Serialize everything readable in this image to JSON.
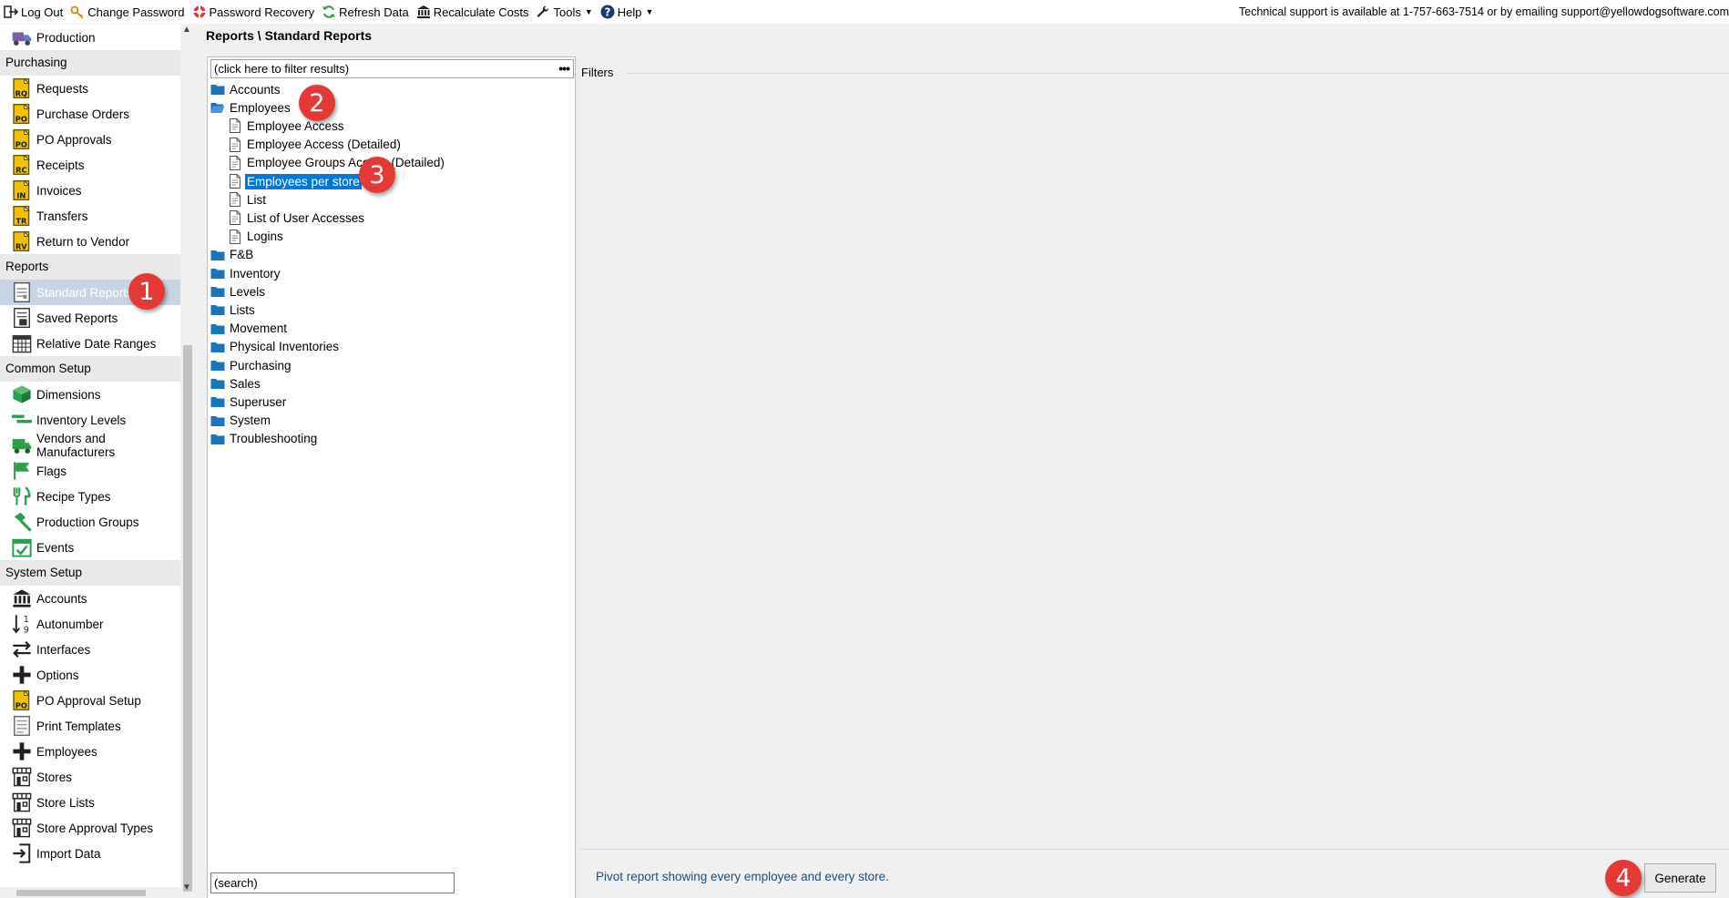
{
  "toolbar": {
    "items": [
      {
        "label": "Log Out",
        "icon": "logout-icon"
      },
      {
        "label": "Change Password",
        "icon": "key-icon"
      },
      {
        "label": "Password Recovery",
        "icon": "lifebuoy-icon"
      },
      {
        "label": "Refresh Data",
        "icon": "refresh-icon"
      },
      {
        "label": "Recalculate Costs",
        "icon": "bank-icon"
      },
      {
        "label": "Tools",
        "icon": "wrench-icon"
      },
      {
        "label": "Help",
        "icon": "help-icon"
      }
    ],
    "support_text": "Technical support is available at 1-757-663-7514 or by emailing support@yellowdogsoftware.com"
  },
  "nav": {
    "items": [
      {
        "type": "item",
        "label": "Production",
        "icon": "truck-icon"
      },
      {
        "type": "section",
        "label": "Purchasing"
      },
      {
        "type": "item",
        "label": "Requests",
        "icon": "doc-rq-icon",
        "code": "RQ"
      },
      {
        "type": "item",
        "label": "Purchase Orders",
        "icon": "doc-po-icon",
        "code": "PO"
      },
      {
        "type": "item",
        "label": "PO Approvals",
        "icon": "doc-po-approval-icon",
        "code": "PO"
      },
      {
        "type": "item",
        "label": "Receipts",
        "icon": "doc-rc-icon",
        "code": "RC"
      },
      {
        "type": "item",
        "label": "Invoices",
        "icon": "doc-in-icon",
        "code": "IN"
      },
      {
        "type": "item",
        "label": "Transfers",
        "icon": "doc-tr-icon",
        "code": "TR"
      },
      {
        "type": "item",
        "label": "Return to Vendor",
        "icon": "doc-rv-icon",
        "code": "RV"
      },
      {
        "type": "section",
        "label": "Reports"
      },
      {
        "type": "item",
        "label": "Standard Reports",
        "icon": "report-icon",
        "selected": true
      },
      {
        "type": "item",
        "label": "Saved Reports",
        "icon": "saved-report-icon"
      },
      {
        "type": "item",
        "label": "Relative Date Ranges",
        "icon": "calendar-icon"
      },
      {
        "type": "section",
        "label": "Common Setup"
      },
      {
        "type": "item",
        "label": "Dimensions",
        "icon": "cube-icon"
      },
      {
        "type": "item",
        "label": "Inventory Levels",
        "icon": "levels-icon"
      },
      {
        "type": "item",
        "label": "Vendors and Manufacturers",
        "icon": "delivery-truck-icon"
      },
      {
        "type": "item",
        "label": "Flags",
        "icon": "flag-icon"
      },
      {
        "type": "item",
        "label": "Recipe Types",
        "icon": "utensils-icon"
      },
      {
        "type": "item",
        "label": "Production Groups",
        "icon": "hammer-icon"
      },
      {
        "type": "item",
        "label": "Events",
        "icon": "calendar-check-icon"
      },
      {
        "type": "section",
        "label": "System Setup"
      },
      {
        "type": "item",
        "label": "Accounts",
        "icon": "bank-icon"
      },
      {
        "type": "item",
        "label": "Autonumber",
        "icon": "sort-numeric-icon"
      },
      {
        "type": "item",
        "label": "Interfaces",
        "icon": "exchange-icon"
      },
      {
        "type": "item",
        "label": "Options",
        "icon": "plus-icon"
      },
      {
        "type": "item",
        "label": "PO Approval Setup",
        "icon": "doc-po-setup-icon",
        "code": "PO"
      },
      {
        "type": "item",
        "label": "Print Templates",
        "icon": "print-template-icon"
      },
      {
        "type": "item",
        "label": "Employees",
        "icon": "plus-icon"
      },
      {
        "type": "item",
        "label": "Stores",
        "icon": "store-icon"
      },
      {
        "type": "item",
        "label": "Store Lists",
        "icon": "store-icon"
      },
      {
        "type": "item",
        "label": "Store Approval Types",
        "icon": "store-icon"
      },
      {
        "type": "item",
        "label": "Import Data",
        "icon": "import-icon"
      }
    ]
  },
  "breadcrumb": "Reports \\ Standard Reports",
  "tree": {
    "filter_placeholder": "(click here to filter results)",
    "search_placeholder": "(search)",
    "nodes": [
      {
        "label": "Accounts",
        "type": "folder",
        "level": 0
      },
      {
        "label": "Employees",
        "type": "folder-open",
        "level": 0
      },
      {
        "label": "Employee Access",
        "type": "report",
        "level": 1
      },
      {
        "label": "Employee Access (Detailed)",
        "type": "report",
        "level": 1
      },
      {
        "label": "Employee Groups Access (Detailed)",
        "type": "report",
        "level": 1
      },
      {
        "label": "Employees per store",
        "type": "report",
        "level": 1,
        "selected": true
      },
      {
        "label": "List",
        "type": "report",
        "level": 1
      },
      {
        "label": "List of User Accesses",
        "type": "report",
        "level": 1
      },
      {
        "label": "Logins",
        "type": "report",
        "level": 1
      },
      {
        "label": "F&B",
        "type": "folder",
        "level": 0
      },
      {
        "label": "Inventory",
        "type": "folder",
        "level": 0
      },
      {
        "label": "Levels",
        "type": "folder",
        "level": 0
      },
      {
        "label": "Lists",
        "type": "folder",
        "level": 0
      },
      {
        "label": "Movement",
        "type": "folder",
        "level": 0
      },
      {
        "label": "Physical Inventories",
        "type": "folder",
        "level": 0
      },
      {
        "label": "Purchasing",
        "type": "folder",
        "level": 0
      },
      {
        "label": "Sales",
        "type": "folder",
        "level": 0
      },
      {
        "label": "Superuser",
        "type": "folder",
        "level": 0
      },
      {
        "label": "System",
        "type": "folder",
        "level": 0
      },
      {
        "label": "Troubleshooting",
        "type": "folder",
        "level": 0
      }
    ]
  },
  "filters_label": "Filters",
  "description": "Pivot report showing every employee and every store.",
  "generate_label": "Generate",
  "badges": [
    "1",
    "2",
    "3",
    "4"
  ],
  "colors": {
    "selection_blue": "#0078d7",
    "nav_selected": "#c8d4e4",
    "folder_blue": "#1e73be",
    "badge_red": "#e53935",
    "doc_yellow": "#f2c200",
    "icon_green": "#2e9e4e",
    "description_text": "#1f4e79"
  }
}
